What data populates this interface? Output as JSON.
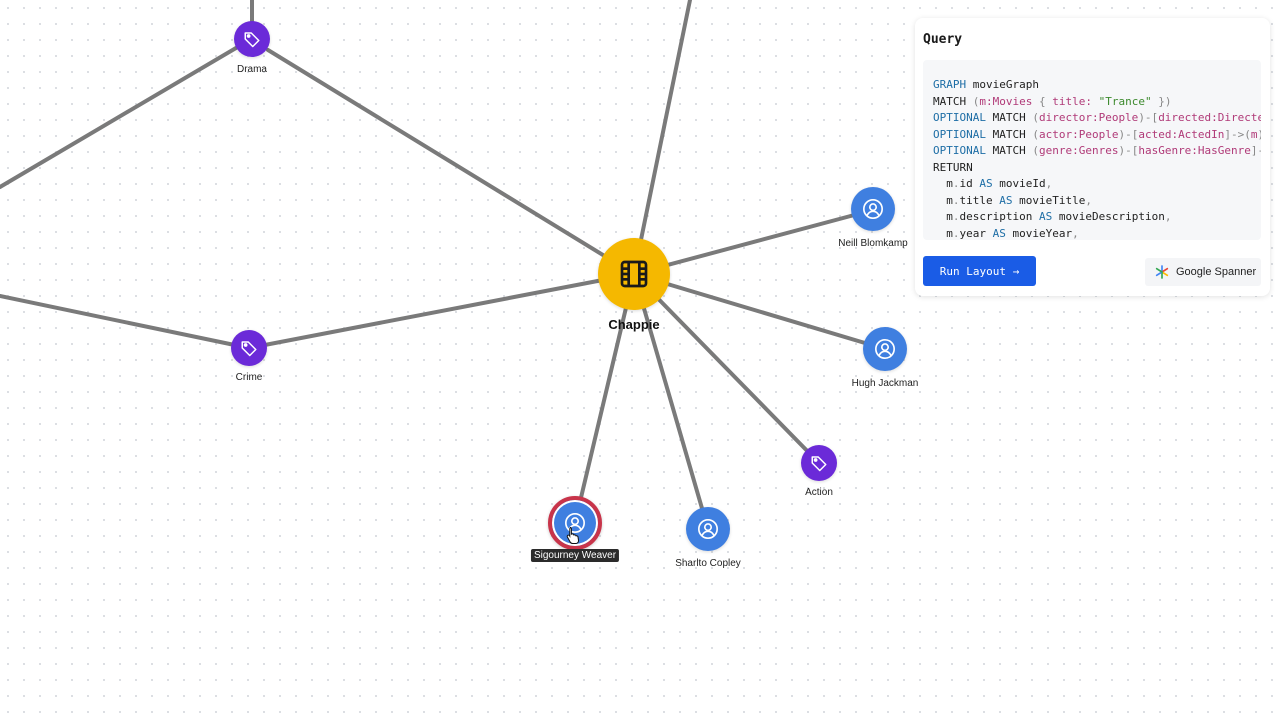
{
  "graph": {
    "movie": {
      "label": "Chappie",
      "icon": "film-icon"
    },
    "genres": [
      {
        "id": "drama",
        "label": "Drama",
        "icon": "tag-icon"
      },
      {
        "id": "crime",
        "label": "Crime",
        "icon": "tag-icon"
      },
      {
        "id": "action",
        "label": "Action",
        "icon": "tag-icon"
      }
    ],
    "people": [
      {
        "id": "neill-blomkamp",
        "label": "Neill Blomkamp",
        "icon": "person-icon"
      },
      {
        "id": "hugh-jackman",
        "label": "Hugh Jackman",
        "icon": "person-icon"
      },
      {
        "id": "sharlto-copley",
        "label": "Sharlto Copley",
        "icon": "person-icon"
      },
      {
        "id": "sigourney-weaver",
        "label": "Sigourney Weaver",
        "icon": "person-icon",
        "selected": true
      }
    ],
    "colors": {
      "movie": "#f5b800",
      "genre": "#6b2ad8",
      "person": "#3f7fe0",
      "selected_ring": "#c8344a",
      "edge": "#7a7a7a"
    }
  },
  "query_panel": {
    "title": "Query",
    "run_button_label": "Run Layout →",
    "brand_label": "Google Spanner",
    "brand_icon": "spanner-logo-icon",
    "code_lines": [
      [
        {
          "t": "GRAPH",
          "c": "kw"
        },
        {
          "t": " movieGraph",
          "c": ""
        }
      ],
      [
        {
          "t": "MATCH",
          "c": ""
        },
        {
          "t": " (",
          "c": "punct"
        },
        {
          "t": "m:Movies",
          "c": "var"
        },
        {
          "t": " { ",
          "c": "punct"
        },
        {
          "t": "title: ",
          "c": "var"
        },
        {
          "t": "\"Trance\"",
          "c": "str"
        },
        {
          "t": " })",
          "c": "punct"
        }
      ],
      [
        {
          "t": "OPTIONAL",
          "c": "kw"
        },
        {
          "t": " MATCH ",
          "c": ""
        },
        {
          "t": "(",
          "c": "punct"
        },
        {
          "t": "director:People",
          "c": "var"
        },
        {
          "t": ")-[",
          "c": "punct"
        },
        {
          "t": "directed:Directe",
          "c": "var"
        }
      ],
      [
        {
          "t": "OPTIONAL",
          "c": "kw"
        },
        {
          "t": " MATCH ",
          "c": ""
        },
        {
          "t": "(",
          "c": "punct"
        },
        {
          "t": "actor:People",
          "c": "var"
        },
        {
          "t": ")-[",
          "c": "punct"
        },
        {
          "t": "acted:ActedIn",
          "c": "var"
        },
        {
          "t": "]->(",
          "c": "punct"
        },
        {
          "t": "m",
          "c": "var"
        },
        {
          "t": ")",
          "c": "punct"
        }
      ],
      [
        {
          "t": "OPTIONAL",
          "c": "kw"
        },
        {
          "t": " MATCH ",
          "c": ""
        },
        {
          "t": "(",
          "c": "punct"
        },
        {
          "t": "genre:Genres",
          "c": "var"
        },
        {
          "t": ")-[",
          "c": "punct"
        },
        {
          "t": "hasGenre:HasGenre",
          "c": "var"
        },
        {
          "t": "]-",
          "c": "punct"
        }
      ],
      [
        {
          "t": "RETURN",
          "c": ""
        }
      ],
      [
        {
          "t": "  m",
          "c": ""
        },
        {
          "t": ".",
          "c": "punct"
        },
        {
          "t": "id ",
          "c": ""
        },
        {
          "t": "AS",
          "c": "kw"
        },
        {
          "t": " movieId",
          "c": ""
        },
        {
          "t": ",",
          "c": "punct"
        }
      ],
      [
        {
          "t": "  m",
          "c": ""
        },
        {
          "t": ".",
          "c": "punct"
        },
        {
          "t": "title ",
          "c": ""
        },
        {
          "t": "AS",
          "c": "kw"
        },
        {
          "t": " movieTitle",
          "c": ""
        },
        {
          "t": ",",
          "c": "punct"
        }
      ],
      [
        {
          "t": "  m",
          "c": ""
        },
        {
          "t": ".",
          "c": "punct"
        },
        {
          "t": "description ",
          "c": ""
        },
        {
          "t": "AS",
          "c": "kw"
        },
        {
          "t": " movieDescription",
          "c": ""
        },
        {
          "t": ",",
          "c": "punct"
        }
      ],
      [
        {
          "t": "  m",
          "c": ""
        },
        {
          "t": ".",
          "c": "punct"
        },
        {
          "t": "year ",
          "c": ""
        },
        {
          "t": "AS",
          "c": "kw"
        },
        {
          "t": " movieYear",
          "c": ""
        },
        {
          "t": ",",
          "c": "punct"
        }
      ]
    ]
  }
}
